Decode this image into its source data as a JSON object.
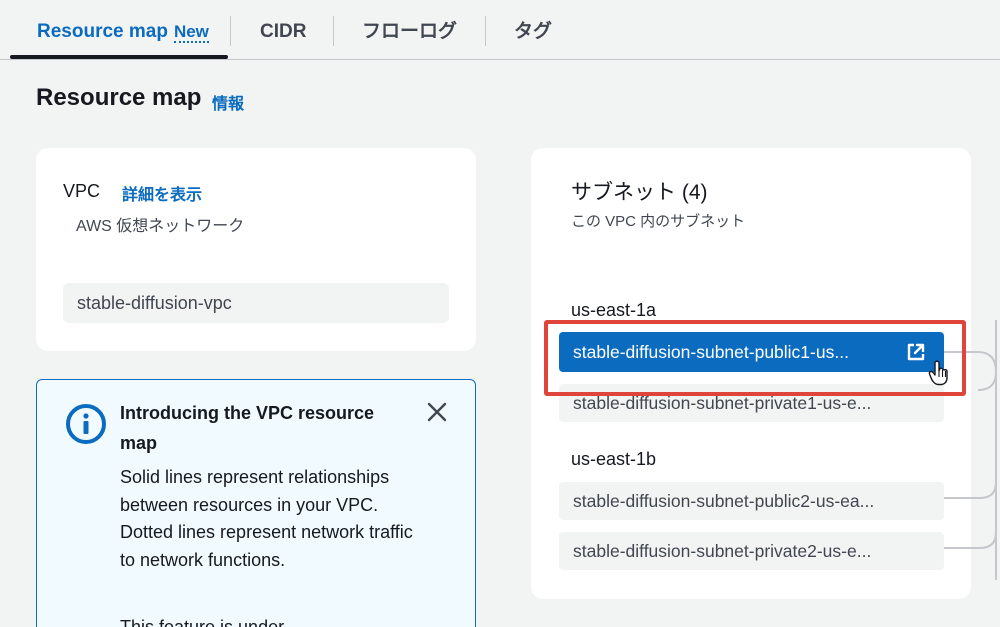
{
  "tabs": [
    {
      "label": "Resource map",
      "badge": "New"
    },
    {
      "label": "CIDR"
    },
    {
      "label": "フローログ"
    },
    {
      "label": "タグ"
    }
  ],
  "header": {
    "title": "Resource map",
    "info_link": "情報"
  },
  "vpc": {
    "label": "VPC",
    "details_link": "詳細を表示",
    "subtitle": "AWS 仮想ネットワーク",
    "name": "stable-diffusion-vpc"
  },
  "info_alert": {
    "title": "Introducing the VPC resource map",
    "body": "Solid lines represent relationships between resources in your VPC. Dotted lines represent network traffic to network functions.",
    "body_more": "This feature is under"
  },
  "subnets": {
    "title": "サブネット (4)",
    "description": "この VPC 内のサブネット",
    "zones": [
      {
        "name": "us-east-1a",
        "items": [
          {
            "label": "stable-diffusion-subnet-public1-us...",
            "selected": true
          },
          {
            "label": "stable-diffusion-subnet-private1-us-e..."
          }
        ]
      },
      {
        "name": "us-east-1b",
        "items": [
          {
            "label": "stable-diffusion-subnet-public2-us-ea..."
          },
          {
            "label": "stable-diffusion-subnet-private2-us-e..."
          }
        ]
      }
    ]
  },
  "colors": {
    "accent": "#0b6bbf",
    "highlight": "#e0453b",
    "info_bg": "#f1faff"
  },
  "icons": [
    "info-circle-icon",
    "close-icon",
    "external-link-icon",
    "hand-pointer-icon"
  ]
}
